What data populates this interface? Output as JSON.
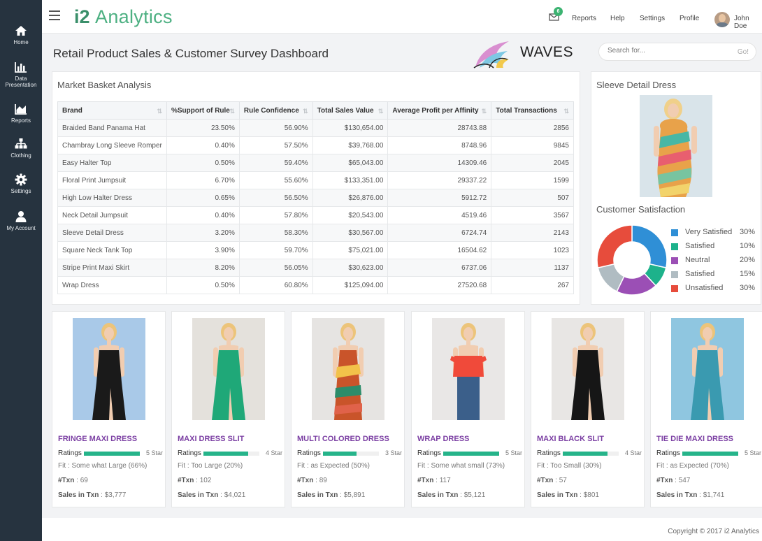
{
  "sidebar": {
    "items": [
      {
        "label": "Home",
        "icon": "home-icon"
      },
      {
        "label": "Data Presentation",
        "icon": "bar-chart-icon"
      },
      {
        "label": "Reports",
        "icon": "area-chart-icon"
      },
      {
        "label": "Clothing",
        "icon": "sitemap-icon"
      },
      {
        "label": "Settings",
        "icon": "gear-icon"
      },
      {
        "label": "My Account",
        "icon": "user-icon"
      }
    ]
  },
  "header": {
    "brand_bold": "i2",
    "brand_light": "Analytics",
    "mail_badge": "6",
    "nav": [
      "Reports",
      "Help",
      "Settings",
      "Profile"
    ],
    "user_name": "John Doe"
  },
  "page": {
    "title": "Retail Product Sales & Customer Survey Dashboard",
    "logo_text": "WAVES",
    "search_placeholder": "Search for...",
    "search_go": "Go!"
  },
  "market_basket": {
    "title": "Market Basket Analysis",
    "columns": [
      "Brand",
      "%Support of Rule",
      "Rule Confidence",
      "Total Sales Value",
      "Average Profit per Affinity",
      "Total Transactions"
    ],
    "rows": [
      [
        "Braided Band Panama Hat",
        "23.50%",
        "56.90%",
        "$130,654.00",
        "28743.88",
        "2856"
      ],
      [
        "Chambray Long Sleeve Romper",
        "0.40%",
        "57.50%",
        "$39,768.00",
        "8748.96",
        "9845"
      ],
      [
        "Easy Halter Top",
        "0.50%",
        "59.40%",
        "$65,043.00",
        "14309.46",
        "2045"
      ],
      [
        "Floral Print Jumpsuit",
        "6.70%",
        "55.60%",
        "$133,351.00",
        "29337.22",
        "1599"
      ],
      [
        "High Low Halter Dress",
        "0.65%",
        "56.50%",
        "$26,876.00",
        "5912.72",
        "507"
      ],
      [
        "Neck Detail Jumpsuit",
        "0.40%",
        "57.80%",
        "$20,543.00",
        "4519.46",
        "3567"
      ],
      [
        "Sleeve Detail Dress",
        "3.20%",
        "58.30%",
        "$30,567.00",
        "6724.74",
        "2143"
      ],
      [
        "Square Neck Tank Top",
        "3.90%",
        "59.70%",
        "$75,021.00",
        "16504.62",
        "1023"
      ],
      [
        "Stripe Print Maxi Skirt",
        "8.20%",
        "56.05%",
        "$30,623.00",
        "6737.06",
        "1137"
      ],
      [
        "Wrap Dress",
        "0.50%",
        "60.80%",
        "$125,094.00",
        "27520.68",
        "267"
      ]
    ]
  },
  "detail": {
    "title": "Sleeve Detail Dress"
  },
  "satisfaction": {
    "title": "Customer Satisfaction",
    "slices": [
      {
        "label": "Very Satisfied",
        "pct": "30%",
        "value": 30,
        "color": "#2f8fd6"
      },
      {
        "label": "Satisfied",
        "pct": "10%",
        "value": 10,
        "color": "#1db28b"
      },
      {
        "label": "Neutral",
        "pct": "20%",
        "value": 20,
        "color": "#9b4fb5"
      },
      {
        "label": "Satisfied",
        "pct": "15%",
        "value": 15,
        "color": "#b0bcc2"
      },
      {
        "label": "Unsatisfied",
        "pct": "30%",
        "value": 30,
        "color": "#e74c3c"
      }
    ]
  },
  "products": [
    {
      "name": "FRINGE MAXI DRESS",
      "rating_label": "Ratings",
      "rating": 5,
      "star_label": "5 Star",
      "fit_label": "Fit",
      "fit": "Some what Large (66%)",
      "txn_label": "#Txn",
      "txn": "69",
      "sales_label": "Sales in Txn",
      "sales": "$3,777",
      "dress_color": "#1a1a1a",
      "bg_color": "#a9c9e8"
    },
    {
      "name": "MAXI DRESS SLIT",
      "rating_label": "Ratings",
      "rating": 4,
      "star_label": "4 Star",
      "fit_label": "Fit",
      "fit": "Too Large (20%)",
      "txn_label": "#Txn",
      "txn": "102",
      "sales_label": "Sales in Txn",
      "sales": "$4,021",
      "dress_color": "#1fa878",
      "bg_color": "#e4e1dc"
    },
    {
      "name": "MULTI COLORED DRESS",
      "rating_label": "Ratings",
      "rating": 3,
      "star_label": "3 Star",
      "fit_label": "Fit",
      "fit": "as Expected (50%)",
      "txn_label": "#Txn",
      "txn": "89",
      "sales_label": "Sales in Txn",
      "sales": "$5,891",
      "dress_color": "#c9542a",
      "bg_color": "#e6e4e2"
    },
    {
      "name": "WRAP DRESS",
      "rating_label": "Ratings",
      "rating": 5,
      "star_label": "5 Star",
      "fit_label": "Fit",
      "fit": "Some what small (73%)",
      "txn_label": "#Txn",
      "txn": "117",
      "sales_label": "Sales in Txn",
      "sales": "$5,121",
      "dress_color": "#f04a3a",
      "bg_color": "#e9e7e6"
    },
    {
      "name": "MAXI BLACK SLIT",
      "rating_label": "Ratings",
      "rating": 4,
      "star_label": "4 Star",
      "fit_label": "Fit",
      "fit": "Too Small (30%)",
      "txn_label": "#Txn",
      "txn": "57",
      "sales_label": "Sales in Txn",
      "sales": "$801",
      "dress_color": "#161616",
      "bg_color": "#e8e6e4"
    },
    {
      "name": "TIE DIE MAXI DRESS",
      "rating_label": "Ratings",
      "rating": 5,
      "star_label": "5 Star",
      "fit_label": "Fit",
      "fit": "as Expected (70%)",
      "txn_label": "#Txn",
      "txn": "547",
      "sales_label": "Sales in Txn",
      "sales": "$1,741",
      "dress_color": "#3a9ab0",
      "bg_color": "#8fc6e0"
    }
  ],
  "footer": {
    "copyright": "Copyright © 2017 i2 Analytics"
  },
  "colors": {
    "sidebar": "#26333f",
    "brand": "#4db082",
    "product_name": "#7b3fa3",
    "rating_bar": "#26b48a"
  }
}
